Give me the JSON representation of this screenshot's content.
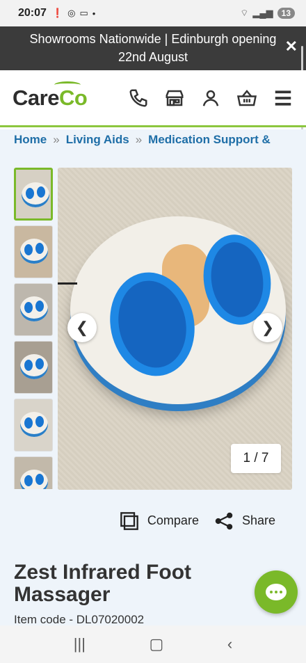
{
  "status_bar": {
    "time": "20:07",
    "notif_icons": [
      "alert-icon",
      "whatsapp-icon",
      "voicemail-icon",
      "dot-icon"
    ],
    "battery": "13"
  },
  "banner": {
    "text": "Showrooms Nationwide | Edinburgh opening 22nd August",
    "close_label": "✕"
  },
  "header": {
    "logo_care": "Care",
    "logo_co": "Co",
    "icons": [
      "phone-icon",
      "store-icon",
      "account-icon",
      "basket-icon",
      "menu-icon"
    ]
  },
  "breadcrumb": {
    "items": [
      "Home",
      "Living Aids",
      "Medication Support &"
    ],
    "separator": "»"
  },
  "gallery": {
    "counter": "1 / 7",
    "prev": "❮",
    "next": "❯"
  },
  "actions": {
    "compare": "Compare",
    "share": "Share"
  },
  "product": {
    "title": "Zest Infrared Foot Massager",
    "item_code": "Item code - DL07020002"
  },
  "colors": {
    "brand_green": "#7ab929",
    "link_blue": "#1e6ea7",
    "banner_bg": "#3b3b3b"
  }
}
